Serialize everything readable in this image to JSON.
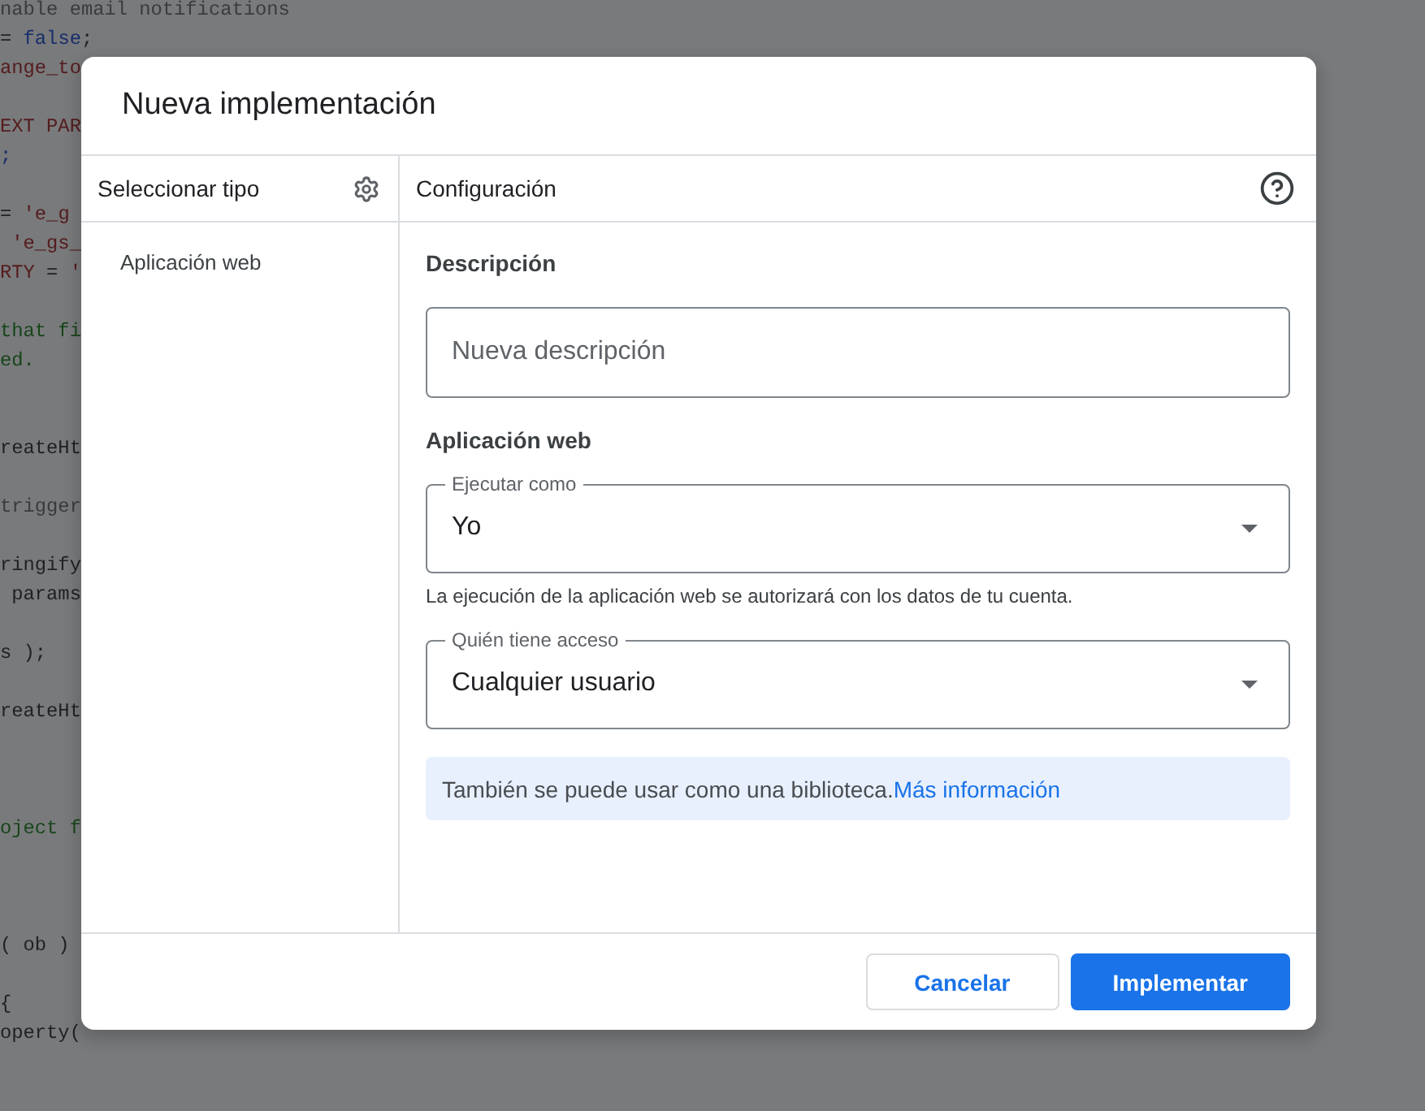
{
  "editor": {
    "lines": [
      {
        "tokens": [
          {
            "kind": "muted",
            "text": "nable email notifications"
          }
        ]
      },
      {
        "tokens": [
          {
            "kind": "plain",
            "text": "= "
          },
          {
            "kind": "keyword",
            "text": "false"
          },
          {
            "kind": "plain",
            "text": ";"
          }
        ]
      },
      {
        "tokens": [
          {
            "kind": "string",
            "text": "ange_to"
          }
        ]
      },
      {
        "tokens": [
          {
            "kind": "string",
            "text": "EXT PAR"
          }
        ]
      },
      {
        "tokens": [
          {
            "kind": "keyword",
            "text": ";"
          }
        ]
      },
      {
        "tokens": [
          {
            "kind": "plain",
            "text": "= "
          },
          {
            "kind": "string",
            "text": "'e_g"
          }
        ]
      },
      {
        "tokens": [
          {
            "kind": "string",
            "text": " 'e_gs_"
          }
        ]
      },
      {
        "tokens": [
          {
            "kind": "string",
            "text": "RTY"
          },
          {
            "kind": "plain",
            "text": " = "
          },
          {
            "kind": "string",
            "text": "'"
          }
        ]
      },
      {
        "tokens": [
          {
            "kind": "comment",
            "text": "that fi"
          }
        ]
      },
      {
        "tokens": [
          {
            "kind": "comment",
            "text": "ed."
          }
        ]
      },
      {
        "tokens": [
          {
            "kind": "plain",
            "text": "reateHt"
          }
        ]
      },
      {
        "tokens": [
          {
            "kind": "muted",
            "text": "trigger"
          }
        ]
      },
      {
        "tokens": [
          {
            "kind": "plain",
            "text": "ringify"
          }
        ]
      },
      {
        "tokens": [
          {
            "kind": "plain",
            "text": " params"
          }
        ]
      },
      {
        "tokens": [
          {
            "kind": "plain",
            "text": "s );"
          }
        ]
      },
      {
        "tokens": [
          {
            "kind": "plain",
            "text": "reateHt"
          }
        ]
      },
      {
        "tokens": [
          {
            "kind": "comment",
            "text": "oject f"
          }
        ]
      },
      {
        "tokens": [
          {
            "kind": "plain",
            "text": "( ob )"
          }
        ]
      },
      {
        "tokens": [
          {
            "kind": "plain",
            "text": "{"
          }
        ]
      },
      {
        "tokens": [
          {
            "kind": "plain",
            "text": "operty("
          }
        ]
      }
    ]
  },
  "dialog": {
    "title": "Nueva implementación",
    "sidebar": {
      "heading": "Seleccionar tipo",
      "items": [
        {
          "label": "Aplicación web",
          "selected": false
        }
      ]
    },
    "config": {
      "heading": "Configuración",
      "description": {
        "label": "Descripción",
        "placeholder": "Nueva descripción"
      },
      "web_app": {
        "heading": "Aplicación web",
        "fields": [
          {
            "label": "Ejecutar como",
            "value": "Yo",
            "hint": "La ejecución de la aplicación web se autorizará con los datos de tu cuenta."
          },
          {
            "label": "Quién tiene acceso",
            "value": "Cualquier usuario"
          }
        ]
      },
      "info": {
        "text": "También se puede usar como una biblioteca.",
        "link": "Más información"
      }
    },
    "buttons": [
      {
        "label": "Cancelar",
        "kind": "secondary"
      },
      {
        "label": "Implementar",
        "kind": "primary"
      }
    ]
  }
}
